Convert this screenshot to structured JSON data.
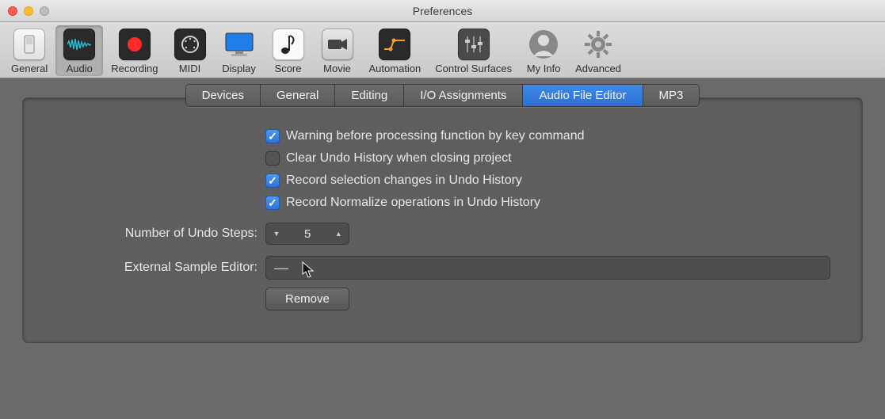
{
  "window": {
    "title": "Preferences"
  },
  "toolbar": {
    "items": [
      {
        "id": "general",
        "label": "General"
      },
      {
        "id": "audio",
        "label": "Audio"
      },
      {
        "id": "recording",
        "label": "Recording"
      },
      {
        "id": "midi",
        "label": "MIDI"
      },
      {
        "id": "display",
        "label": "Display"
      },
      {
        "id": "score",
        "label": "Score"
      },
      {
        "id": "movie",
        "label": "Movie"
      },
      {
        "id": "automation",
        "label": "Automation"
      },
      {
        "id": "surfaces",
        "label": "Control Surfaces"
      },
      {
        "id": "myinfo",
        "label": "My Info"
      },
      {
        "id": "advanced",
        "label": "Advanced"
      }
    ],
    "selected": "audio"
  },
  "tabs": {
    "items": [
      {
        "id": "devices",
        "label": "Devices"
      },
      {
        "id": "general",
        "label": "General"
      },
      {
        "id": "editing",
        "label": "Editing"
      },
      {
        "id": "io",
        "label": "I/O Assignments"
      },
      {
        "id": "afe",
        "label": "Audio File Editor"
      },
      {
        "id": "mp3",
        "label": "MP3"
      }
    ],
    "active": "afe"
  },
  "checkboxes": [
    {
      "id": "warn",
      "label": "Warning before processing function by key command",
      "checked": true
    },
    {
      "id": "clear",
      "label": "Clear Undo History when closing project",
      "checked": false
    },
    {
      "id": "recsel",
      "label": "Record selection changes in Undo History",
      "checked": true
    },
    {
      "id": "recnorm",
      "label": "Record Normalize operations in Undo History",
      "checked": true
    }
  ],
  "undo_steps": {
    "label": "Number of Undo Steps:",
    "value": "5"
  },
  "ext_editor": {
    "label": "External Sample Editor:",
    "value": "—"
  },
  "remove_button": {
    "label": "Remove"
  }
}
